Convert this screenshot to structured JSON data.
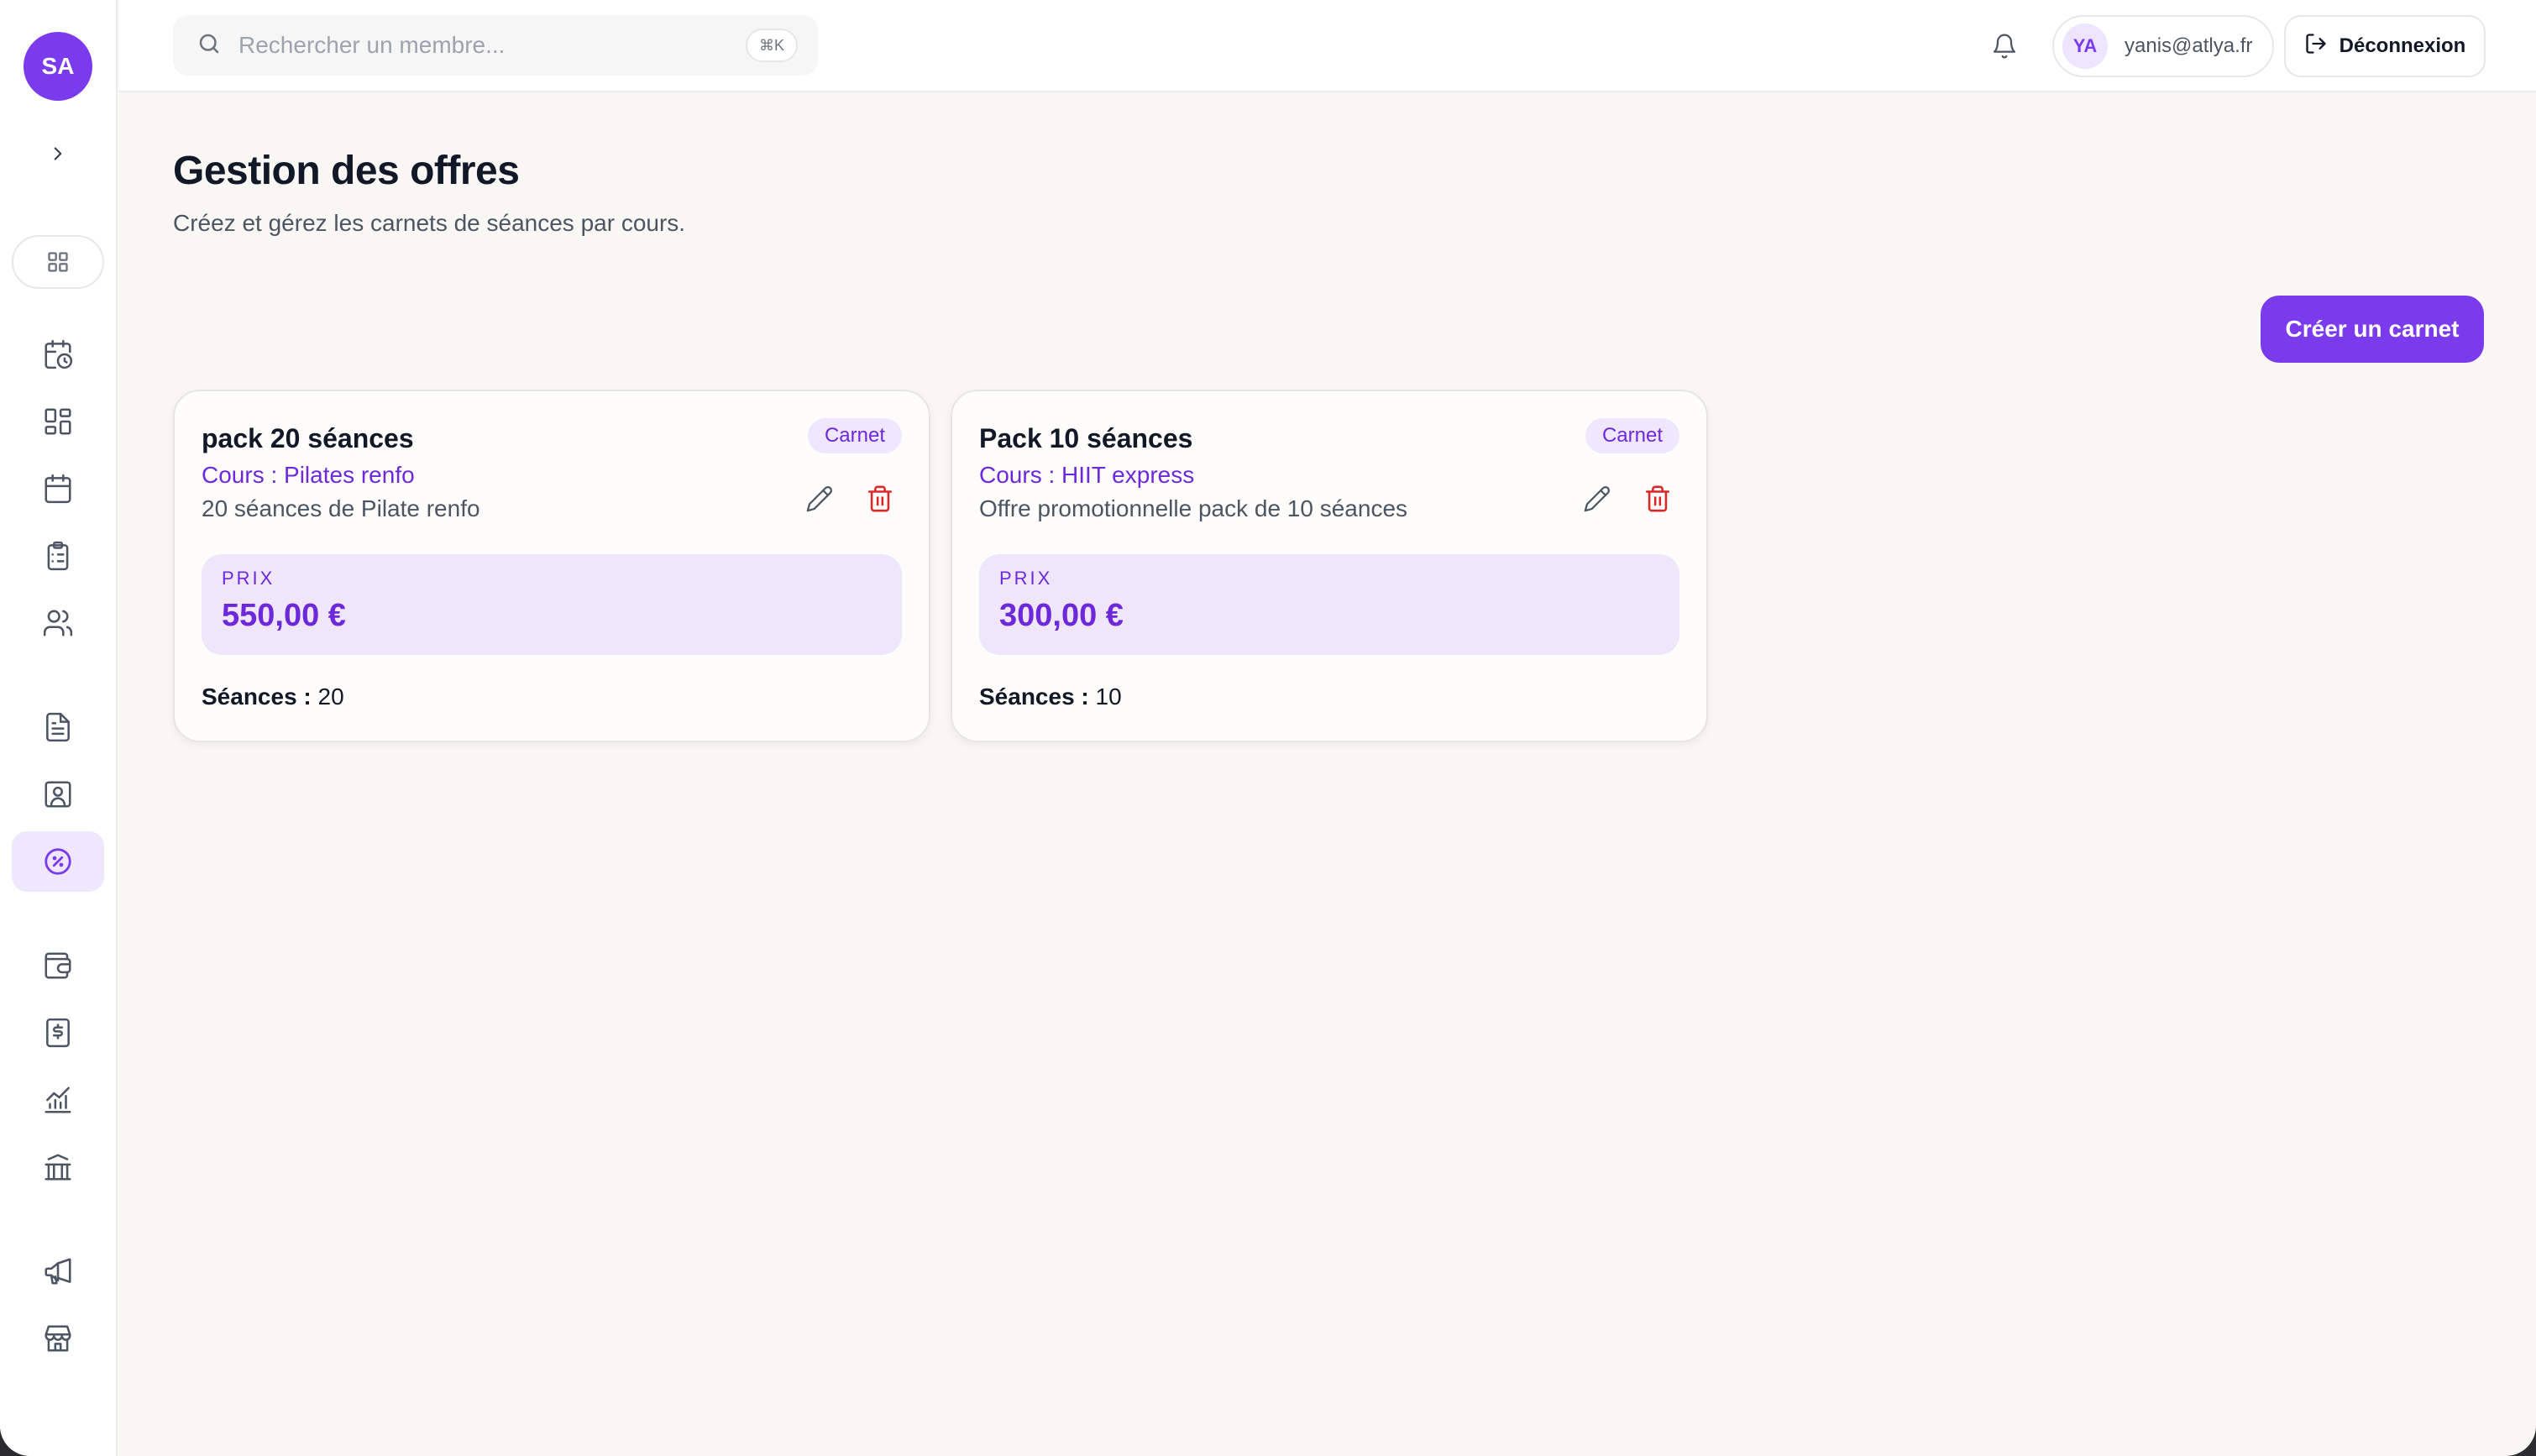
{
  "sidebar": {
    "avatar_initials": "SA",
    "icons": [
      "chevron-right-icon",
      "grid-icon",
      "calendar-clock-icon",
      "dashboard-icon",
      "calendar-icon",
      "clipboard-list-icon",
      "users-icon",
      "document-icon",
      "contact-card-icon",
      "discount-badge-icon",
      "wallet-icon",
      "invoice-dollar-icon",
      "analytics-chart-icon",
      "bank-icon",
      "megaphone-icon",
      "store-icon"
    ],
    "active_item": "discount-badge-icon"
  },
  "topbar": {
    "search_placeholder": "Rechercher un membre...",
    "search_shortcut": "⌘K",
    "user_initials": "YA",
    "user_email": "yanis@atlya.fr",
    "logout_label": "Déconnexion"
  },
  "page": {
    "title": "Gestion des offres",
    "subtitle": "Créez et gérez les carnets de séances par cours.",
    "create_button": "Créer un carnet"
  },
  "cards": [
    {
      "title": "pack 20 séances",
      "course": "Cours : Pilates renfo",
      "description": "20 séances de Pilate renfo",
      "badge": "Carnet",
      "price_label": "PRIX",
      "price": "550,00 €",
      "sessions_label": "Séances :",
      "sessions_value": "20"
    },
    {
      "title": "Pack 10 séances",
      "course": "Cours : HIIT express",
      "description": "Offre promotionnelle pack de 10 séances",
      "badge": "Carnet",
      "price_label": "PRIX",
      "price": "300,00 €",
      "sessions_label": "Séances :",
      "sessions_value": "10"
    }
  ],
  "colors": {
    "accent": "#7c3aed",
    "accent_light": "#efe7fd",
    "danger": "#dc2626",
    "background": "#f9f7f4"
  }
}
